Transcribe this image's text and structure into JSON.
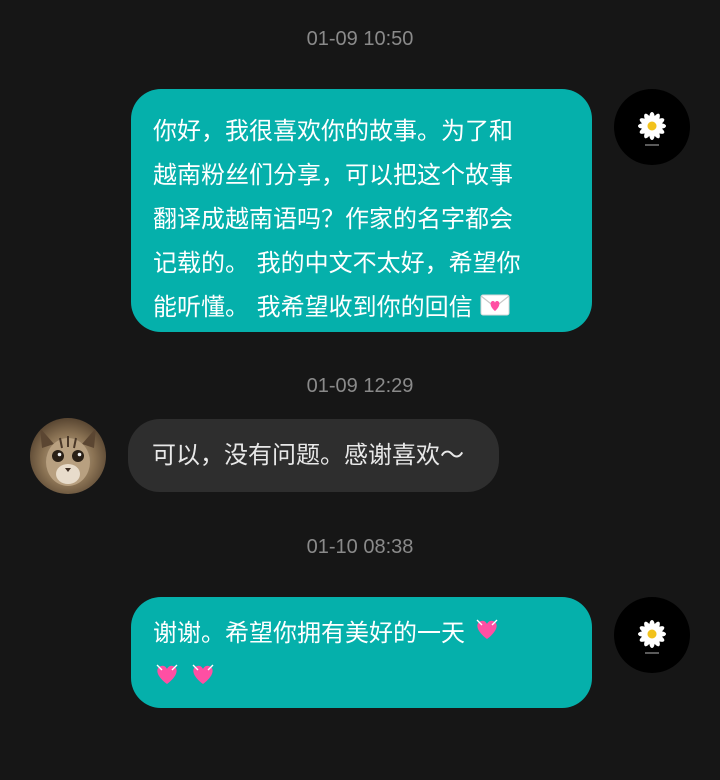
{
  "conversation": {
    "timestamps": [
      "01-09 10:50",
      "01-09 12:29",
      "01-10 08:38"
    ],
    "messages": [
      {
        "direction": "outgoing",
        "lines": [
          "你好，我很喜欢你的故事。为了和",
          "越南粉丝们分享，可以把这个故事",
          "翻译成越南语吗？作家的名字都会",
          "记载的。 我的中文不太好，希望你",
          "能听懂。 我希望收到你的回信"
        ],
        "emoji": "love-letter-icon"
      },
      {
        "direction": "incoming",
        "text": "可以，没有问题。感谢喜欢～"
      },
      {
        "direction": "outgoing",
        "lines": [
          "谢谢。希望你拥有美好的一天"
        ],
        "emoji": "heart-with-ribbon-icon"
      }
    ]
  },
  "colors": {
    "background": "#161616",
    "outgoing_bubble": "#05b0ab",
    "incoming_bubble": "#2e2e2e",
    "timestamp": "#8a8a8a",
    "heart": "#ff4fa3"
  },
  "icons": {
    "self_avatar": "daisy-avatar-icon",
    "contact_avatar": "cat-avatar-icon"
  }
}
